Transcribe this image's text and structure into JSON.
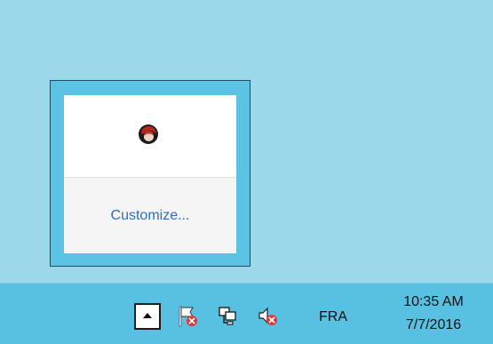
{
  "overflow_popup": {
    "customize_label": "Customize...",
    "icons": [
      {
        "name": "app-avatar-icon",
        "color": "#b5281d"
      }
    ]
  },
  "taskbar": {
    "expand_icon": "chevron-up-icon",
    "tray_icons": [
      {
        "name": "action-center-flag-icon"
      },
      {
        "name": "network-icon"
      },
      {
        "name": "volume-muted-icon"
      }
    ],
    "language": "FRA",
    "clock": {
      "time": "10:35 AM",
      "date": "7/7/2016"
    }
  },
  "colors": {
    "desktop": "#9dd8ea",
    "taskbar": "#58c0e1",
    "popup_border": "#5cc3e4",
    "link": "#2e6fc2",
    "error_badge": "#e1373b"
  }
}
